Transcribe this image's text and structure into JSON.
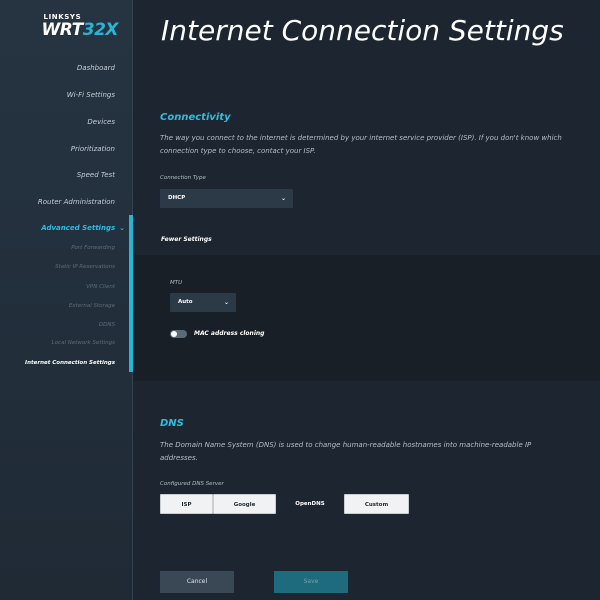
{
  "logo": {
    "brand": "LINKSYS",
    "model_prefix": "WRT",
    "model_suffix": "32X"
  },
  "sidebar": {
    "items": [
      {
        "label": "Dashboard"
      },
      {
        "label": "Wi-Fi Settings"
      },
      {
        "label": "Devices"
      },
      {
        "label": "Prioritization"
      },
      {
        "label": "Speed Test"
      },
      {
        "label": "Router Administration"
      },
      {
        "label": "Advanced Settings"
      }
    ],
    "sub_items": [
      {
        "label": "Port Forwarding"
      },
      {
        "label": "Static IP Reservations"
      },
      {
        "label": "VPN Client"
      },
      {
        "label": "External Storage"
      },
      {
        "label": "DDNS"
      },
      {
        "label": "Local Network Settings"
      },
      {
        "label": "Internet Connection Settings"
      }
    ],
    "chevron": "⌄",
    "accent_color": "#27b5d6"
  },
  "page": {
    "title": "Internet Connection Settings"
  },
  "connectivity": {
    "title": "Connectivity",
    "description": "The way you connect to the internet is determined by your internet service provider (ISP). If you don't know which connection type to choose, contact your ISP.",
    "connection_type_label": "Connection Type",
    "connection_type_value": "DHCP",
    "fewer_settings": "Fewer Settings",
    "mtu_label": "MTU",
    "mtu_value": "Auto",
    "mac_cloning_label": "MAC address cloning",
    "mac_cloning_enabled": false
  },
  "dns": {
    "title": "DNS",
    "description": "The Domain Name System (DNS) is used to change human-readable hostnames into machine-readable IP addresses.",
    "configured_label": "Configured DNS Server",
    "options": [
      "ISP",
      "Google",
      "OpenDNS",
      "Custom"
    ],
    "selected": "OpenDNS"
  },
  "actions": {
    "cancel": "Cancel",
    "save": "Save"
  }
}
